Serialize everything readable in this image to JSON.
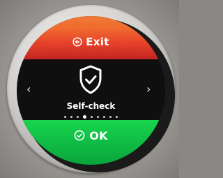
{
  "screen": {
    "title": "Self-check",
    "exit": {
      "label": "Exit",
      "icon": "exit-arrow-icon"
    },
    "ok": {
      "label": "OK",
      "icon": "check-circle-icon"
    },
    "nav": {
      "prev": "‹",
      "next": "›"
    },
    "main_icon": "shield-check-icon",
    "pager": {
      "count": 9,
      "active_index": 3
    },
    "colors": {
      "exit_band": "#e5402a",
      "ok_band": "#10c146",
      "background": "#0f0f0f",
      "text": "#ffffff"
    }
  }
}
